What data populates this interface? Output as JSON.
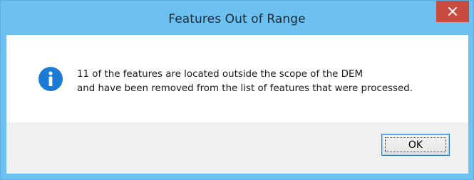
{
  "window": {
    "title": "Features Out of Range",
    "close_icon": "close-icon"
  },
  "message": {
    "icon": "info-icon",
    "line1": "11 of the features are located outside the scope of the DEM",
    "line2": "and have been removed from the list of features that were processed."
  },
  "buttons": {
    "ok_label": "OK"
  },
  "colors": {
    "titlebar": "#6cc1f0",
    "close_button": "#c94a3e",
    "info_icon": "#1a7ad4",
    "focus_border": "#2e7fd1"
  }
}
